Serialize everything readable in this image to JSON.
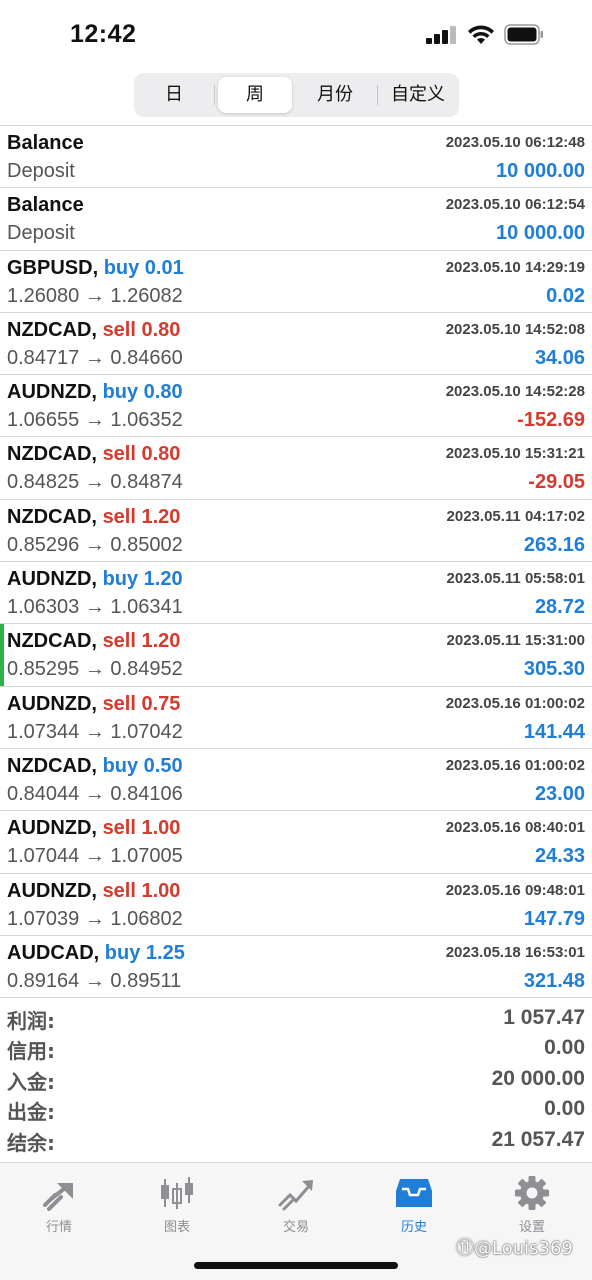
{
  "status": {
    "time": "12:42"
  },
  "segments": [
    "日",
    "周",
    "月份",
    "自定义"
  ],
  "rows": [
    {
      "title": "Balance",
      "side": "",
      "side_color": "",
      "time": "2023.05.10 06:12:48",
      "sub": "Deposit",
      "amount": "10 000.00",
      "amount_color": "blue"
    },
    {
      "title": "Balance",
      "side": "",
      "side_color": "",
      "time": "2023.05.10 06:12:54",
      "sub": "Deposit",
      "amount": "10 000.00",
      "amount_color": "blue"
    },
    {
      "title": "GBPUSD,",
      "side": "buy 0.01",
      "side_color": "blue",
      "time": "2023.05.10 14:29:19",
      "sub": "1.26080 → 1.26082",
      "amount": "0.02",
      "amount_color": "blue"
    },
    {
      "title": "NZDCAD,",
      "side": "sell 0.80",
      "side_color": "red",
      "time": "2023.05.10 14:52:08",
      "sub": "0.84717 → 0.84660",
      "amount": "34.06",
      "amount_color": "blue"
    },
    {
      "title": "AUDNZD,",
      "side": "buy 0.80",
      "side_color": "blue",
      "time": "2023.05.10 14:52:28",
      "sub": "1.06655 → 1.06352",
      "amount": "-152.69",
      "amount_color": "red"
    },
    {
      "title": "NZDCAD,",
      "side": "sell 0.80",
      "side_color": "red",
      "time": "2023.05.10 15:31:21",
      "sub": "0.84825 → 0.84874",
      "amount": "-29.05",
      "amount_color": "red"
    },
    {
      "title": "NZDCAD,",
      "side": "sell 1.20",
      "side_color": "red",
      "time": "2023.05.11 04:17:02",
      "sub": "0.85296 → 0.85002",
      "amount": "263.16",
      "amount_color": "blue"
    },
    {
      "title": "AUDNZD,",
      "side": "buy 1.20",
      "side_color": "blue",
      "time": "2023.05.11 05:58:01",
      "sub": "1.06303 → 1.06341",
      "amount": "28.72",
      "amount_color": "blue"
    },
    {
      "title": "NZDCAD,",
      "side": "sell 1.20",
      "side_color": "red",
      "time": "2023.05.11 15:31:00",
      "sub": "0.85295 → 0.84952",
      "amount": "305.30",
      "amount_color": "blue",
      "marked": true
    },
    {
      "title": "AUDNZD,",
      "side": "sell 0.75",
      "side_color": "red",
      "time": "2023.05.16 01:00:02",
      "sub": "1.07344 → 1.07042",
      "amount": "141.44",
      "amount_color": "blue"
    },
    {
      "title": "NZDCAD,",
      "side": "buy 0.50",
      "side_color": "blue",
      "time": "2023.05.16 01:00:02",
      "sub": "0.84044 → 0.84106",
      "amount": "23.00",
      "amount_color": "blue"
    },
    {
      "title": "AUDNZD,",
      "side": "sell 1.00",
      "side_color": "red",
      "time": "2023.05.16 08:40:01",
      "sub": "1.07044 → 1.07005",
      "amount": "24.33",
      "amount_color": "blue"
    },
    {
      "title": "AUDNZD,",
      "side": "sell 1.00",
      "side_color": "red",
      "time": "2023.05.16 09:48:01",
      "sub": "1.07039 → 1.06802",
      "amount": "147.79",
      "amount_color": "blue"
    },
    {
      "title": "AUDCAD,",
      "side": "buy 1.25",
      "side_color": "blue",
      "time": "2023.05.18 16:53:01",
      "sub": "0.89164 → 0.89511",
      "amount": "321.48",
      "amount_color": "blue"
    }
  ],
  "summary": [
    {
      "label": "利润:",
      "value": "1 057.47"
    },
    {
      "label": "信用:",
      "value": "0.00"
    },
    {
      "label": "入金:",
      "value": "20 000.00"
    },
    {
      "label": "出金:",
      "value": "0.00"
    },
    {
      "label": "结余:",
      "value": "21 057.47"
    }
  ],
  "tabs": [
    {
      "label": "行情",
      "icon": "quotes-icon"
    },
    {
      "label": "图表",
      "icon": "chart-icon"
    },
    {
      "label": "交易",
      "icon": "trade-icon"
    },
    {
      "label": "历史",
      "icon": "history-icon",
      "active": true
    },
    {
      "label": "设置",
      "icon": "settings-icon"
    }
  ],
  "watermark": "⑪@Louis369",
  "colors": {
    "blue": "#1f7ed8",
    "red": "#d63a2e",
    "marker_green": "#2db34a"
  }
}
